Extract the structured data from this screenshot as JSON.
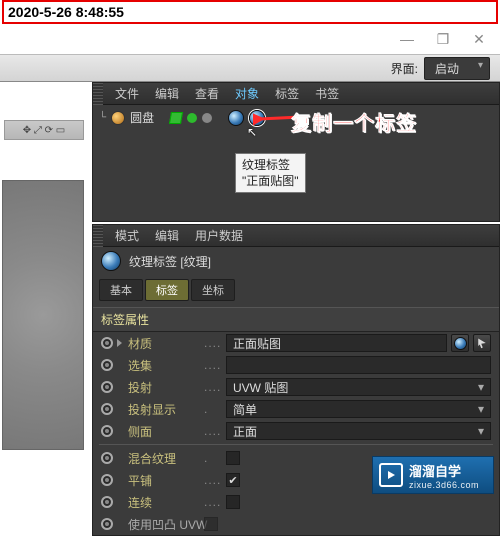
{
  "timestamp": "2020-5-26 8:48:55",
  "titlebar": {
    "minimize": "—",
    "restore": "❐",
    "close": "✕"
  },
  "layout_bar": {
    "label": "界面:",
    "value": "启动"
  },
  "object_panel": {
    "menu": [
      "文件",
      "编辑",
      "查看",
      "对象",
      "标签",
      "书签"
    ],
    "active_index": 3,
    "row": {
      "label": "圆盘"
    },
    "tooltip_line1": "纹理标签",
    "tooltip_line2": "\"正面贴图\"",
    "callout": "复制一个标签"
  },
  "attr_panel": {
    "menu": [
      "模式",
      "编辑",
      "用户数据"
    ],
    "header": "纹理标签 [纹理]",
    "tabs": [
      "基本",
      "标签",
      "坐标"
    ],
    "active_tab": 1,
    "section": "标签属性",
    "rows": [
      {
        "label": "材质",
        "value": "正面贴图",
        "type": "material"
      },
      {
        "label": "选集",
        "value": "",
        "type": "text"
      },
      {
        "label": "投射",
        "value": "UVW 贴图",
        "type": "dropdown"
      },
      {
        "label": "投射显示",
        "value": "简单",
        "type": "dropdown"
      },
      {
        "label": "侧面",
        "value": "正面",
        "type": "dropdown"
      },
      {
        "label": "混合纹理",
        "checked": false,
        "type": "check"
      },
      {
        "label": "平铺",
        "checked": true,
        "type": "check"
      },
      {
        "label": "连续",
        "checked": false,
        "type": "check"
      },
      {
        "label": "使用凹凸 UVW",
        "checked": false,
        "type": "check-gray"
      }
    ]
  },
  "watermark": {
    "title": "溜溜自学",
    "sub": "zixue.3d66.com"
  }
}
